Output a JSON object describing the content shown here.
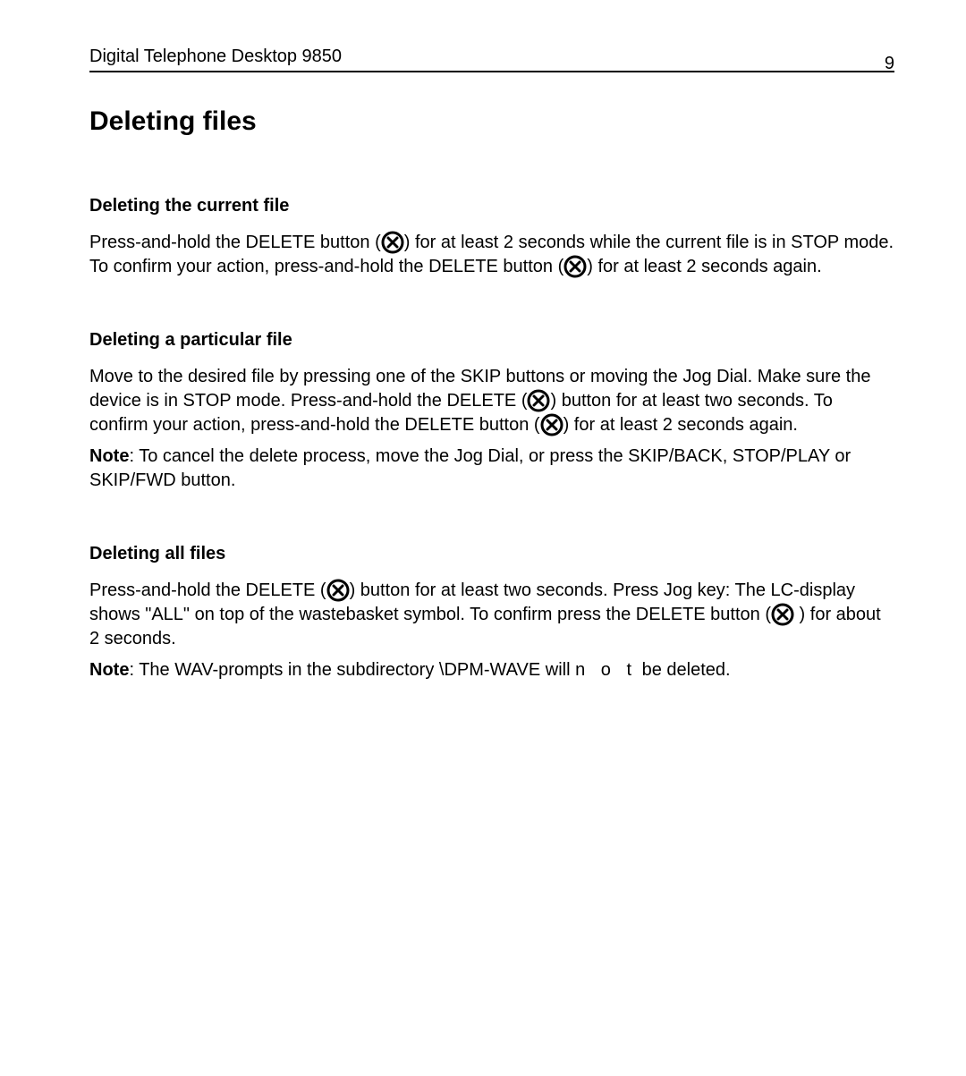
{
  "header": {
    "title": "Digital Telephone Desktop 9850",
    "page_number": "9"
  },
  "main_heading": "Deleting files",
  "sections": {
    "s1": {
      "heading": "Deleting the current file",
      "p1a": "Press-and-hold the DELETE button (",
      "p1b": ") for at least 2 seconds while the current file is in STOP mode. To confirm your action, press-and-hold the DELETE button (",
      "p1c": ") for at least 2 seconds again."
    },
    "s2": {
      "heading": "Deleting a particular file",
      "p1a": "Move to the desired file by pressing one of the SKIP buttons or moving the Jog Dial. Make sure the device is in STOP mode. Press-and-hold the DELETE (",
      "p1b": ") button for at least two seconds. To confirm your action, press-and-hold the DELETE button (",
      "p1c": ") for at least 2 seconds again.",
      "note_label": "Note",
      "note_text": ": To cancel the delete process, move the Jog Dial, or press the SKIP/BACK, STOP/PLAY or SKIP/FWD button."
    },
    "s3": {
      "heading": "Deleting all files",
      "p1a": "Press-and-hold the DELETE (",
      "p1b": ") button for at least two seconds. Press Jog key: The LC-display shows \"ALL\" on top of the wastebasket symbol. To confirm press the DELETE button (",
      "p1c": " ) for about 2 seconds.",
      "note_label": "Note",
      "note_text_a": ": The WAV-prompts in the subdirectory \\DPM-WAVE will ",
      "note_spaced": "n o t",
      "note_text_b": "  be deleted."
    }
  },
  "icons": {
    "delete": "delete-circle-x-icon"
  }
}
